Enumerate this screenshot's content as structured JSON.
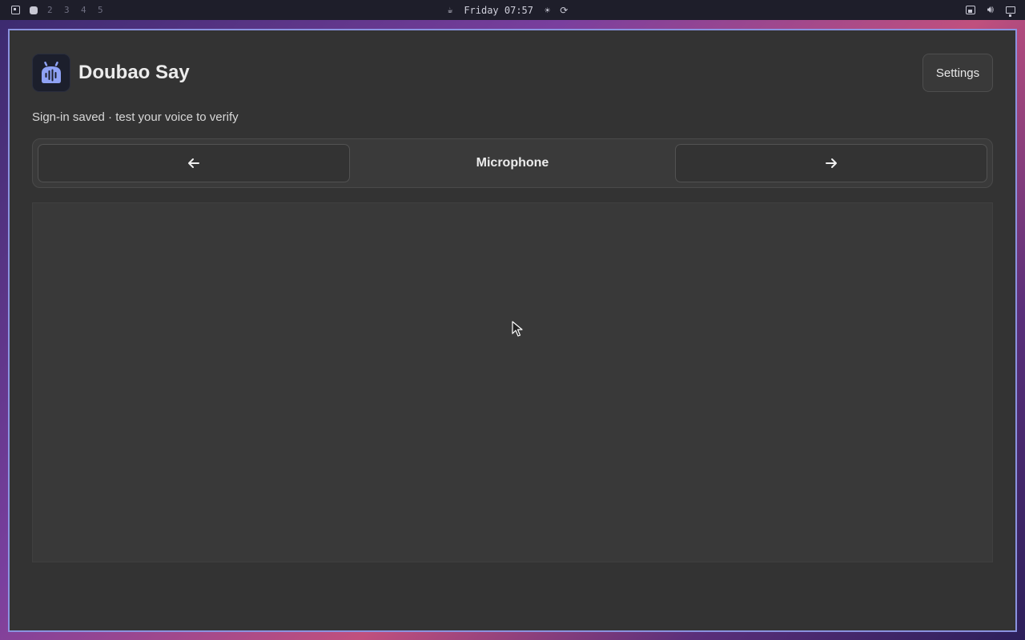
{
  "topbar": {
    "workspaces": [
      "2",
      "3",
      "4",
      "5"
    ],
    "clock": "Friday 07:57",
    "icons": {
      "launcher": "layout-grid-icon",
      "active_workspace": "workspace-active-icon",
      "notification": "notification-icon",
      "brightness": "sun-icon",
      "refresh": "refresh-icon",
      "network": "network-icon",
      "volume": "volume-icon",
      "display": "monitor-icon"
    }
  },
  "app": {
    "title": "Doubao Say",
    "icon": "voice-assistant-icon",
    "settings_label": "Settings",
    "status": "Sign-in saved · test your voice to verify"
  },
  "nav": {
    "prev_icon": "arrow-left-icon",
    "label": "Microphone",
    "next_icon": "arrow-right-icon"
  },
  "colors": {
    "window_border": "#8b93e0",
    "window_bg": "#333333",
    "app_icon_accent": "#8fa2f5"
  }
}
